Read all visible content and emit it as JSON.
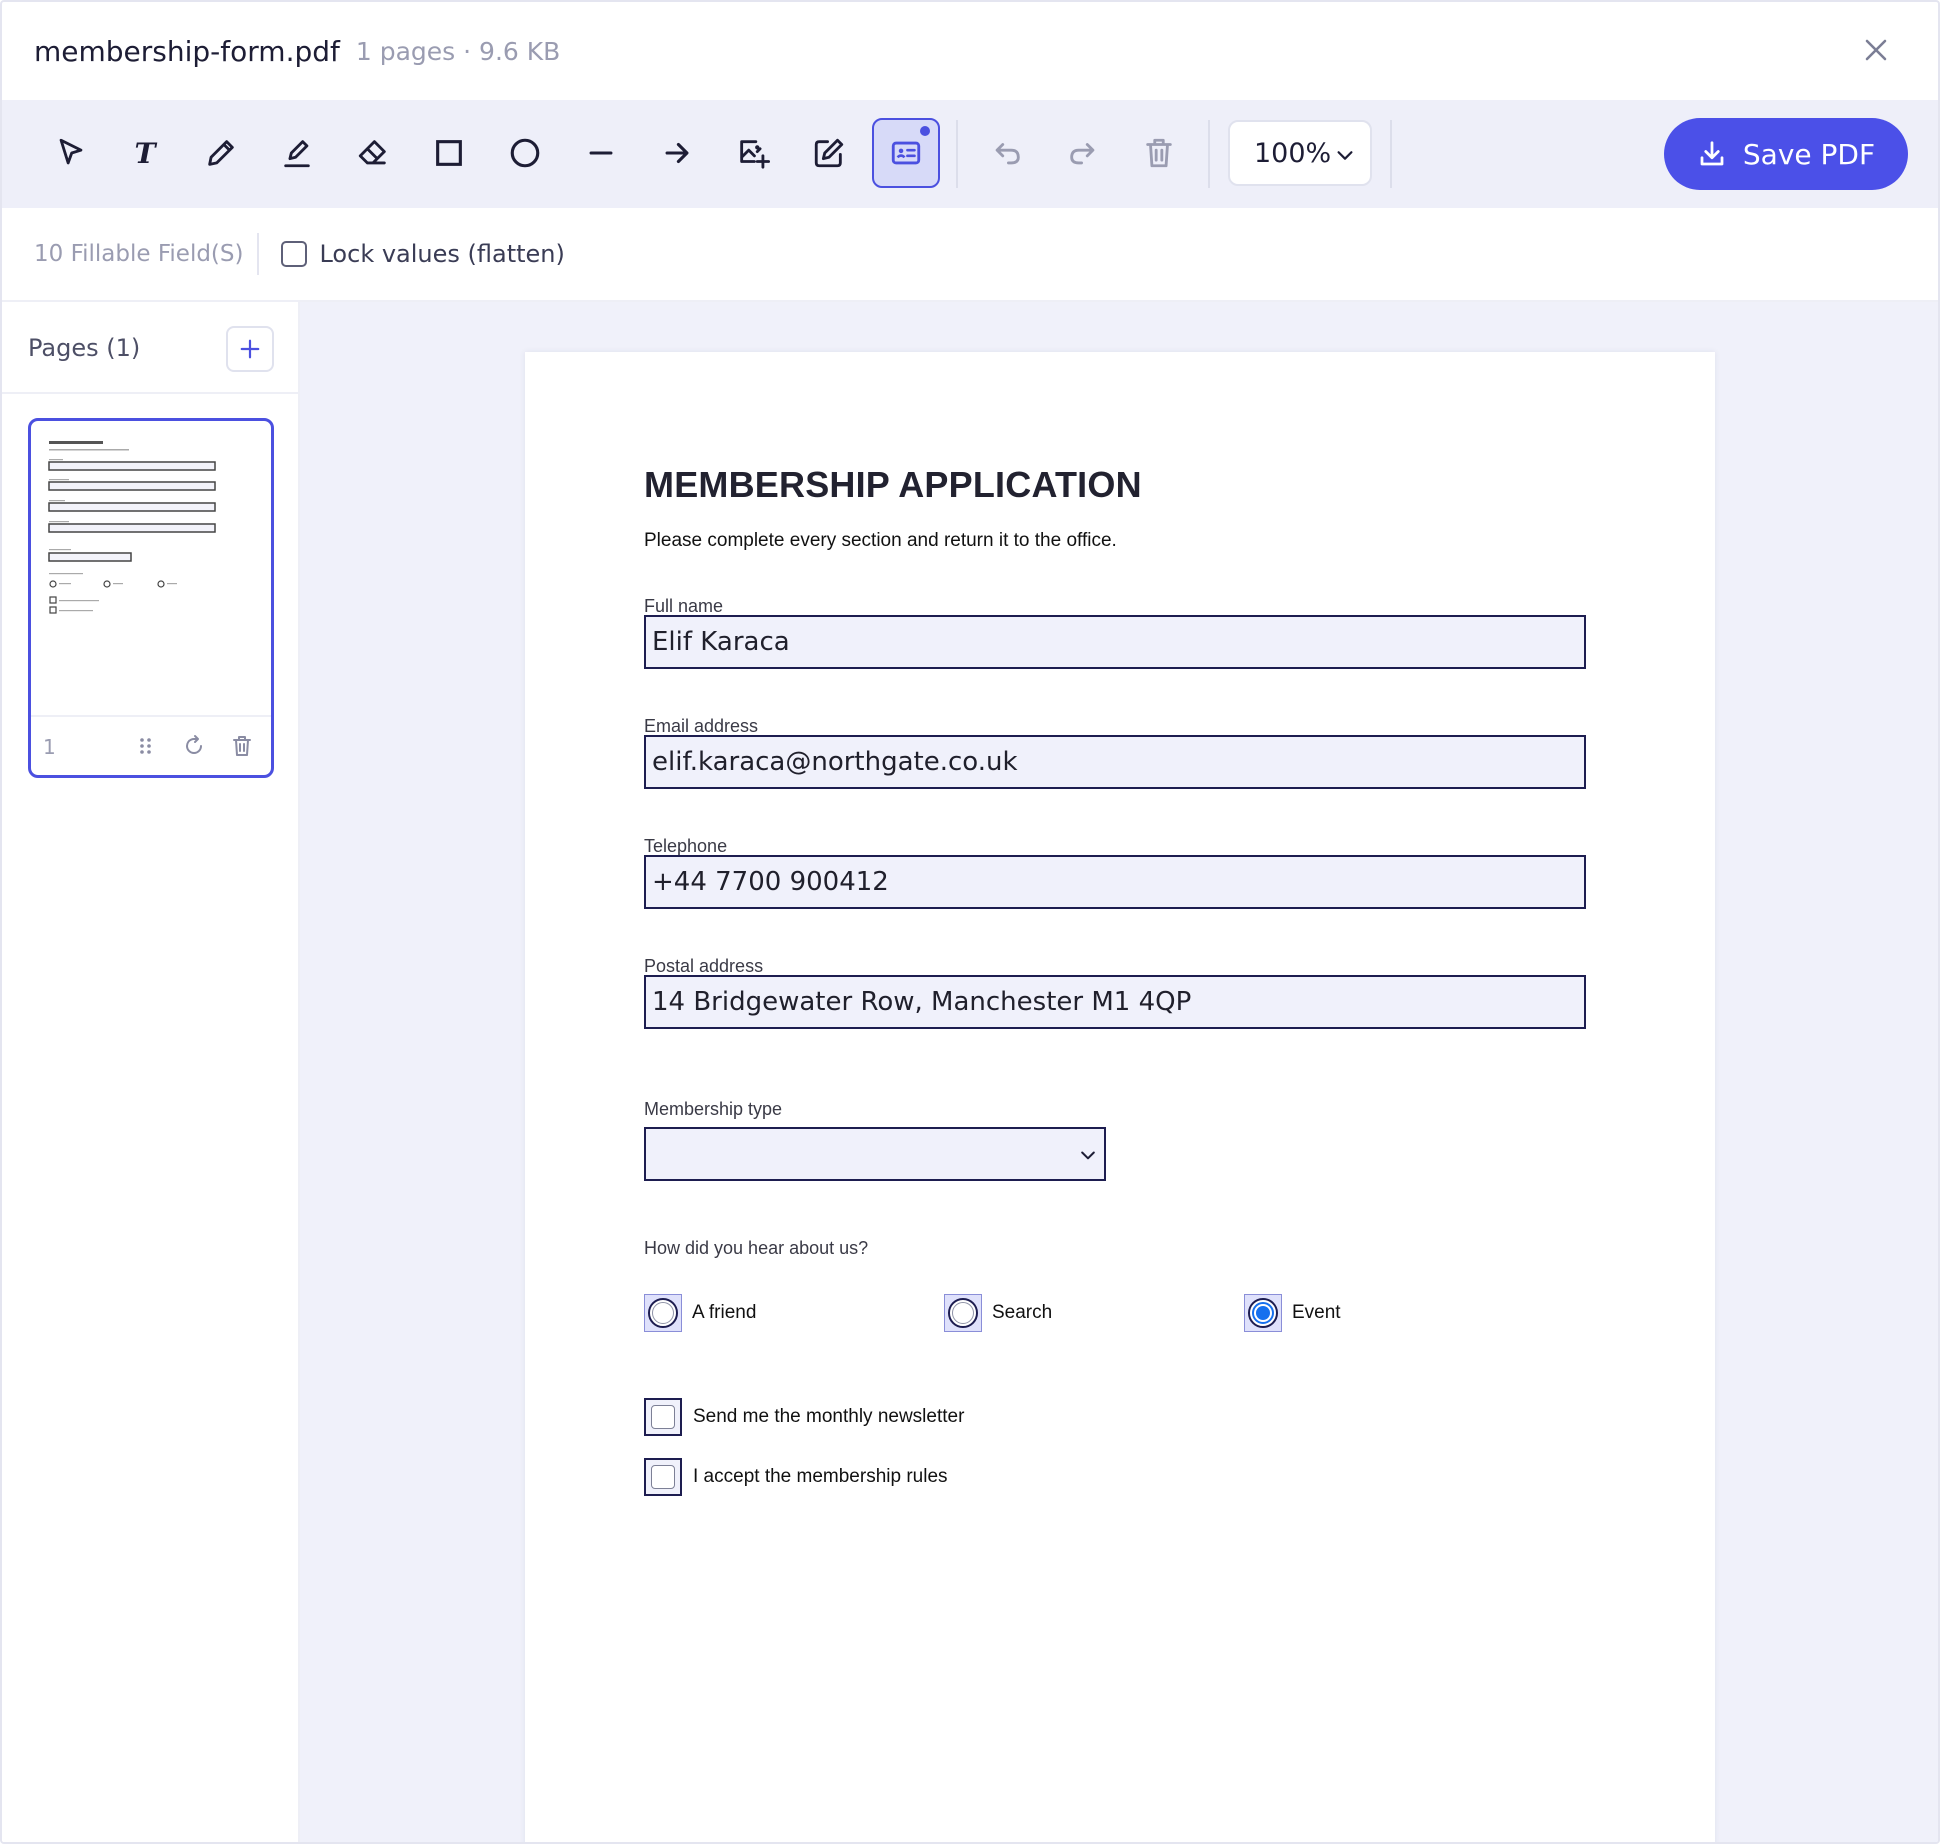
{
  "header": {
    "file_name": "membership-form.pdf",
    "file_meta": "1 pages · 9.6 KB"
  },
  "toolbar": {
    "tools": [
      "select-tool",
      "text-tool",
      "pen-tool",
      "highlighter-tool",
      "eraser-tool",
      "rectangle-tool",
      "ellipse-tool",
      "line-tool",
      "arrow-tool",
      "insert-image-tool",
      "edit-tool",
      "form-fields-tool"
    ],
    "active_tool": "form-fields-tool",
    "zoom": "100%",
    "save_label": "Save PDF",
    "accent_color": "#4b50e8"
  },
  "fields_bar": {
    "count_label": "10 Fillable Field(S)",
    "lock_label": "Lock values (flatten)",
    "lock_checked": false
  },
  "sidebar": {
    "title": "Pages (1)",
    "pages": [
      {
        "number": "1"
      }
    ]
  },
  "document": {
    "title": "MEMBERSHIP APPLICATION",
    "subtitle": "Please complete every section and return it to the office.",
    "fields": {
      "full_name": {
        "label": "Full name",
        "value": "Elif Karaca"
      },
      "email": {
        "label": "Email address",
        "value": "elif.karaca@northgate.co.uk"
      },
      "telephone": {
        "label": "Telephone",
        "value": "+44 7700 900412"
      },
      "postal": {
        "label": "Postal address",
        "value": "14 Bridgewater Row, Manchester M1 4QP"
      }
    },
    "membership_type": {
      "label": "Membership type",
      "value": ""
    },
    "hear_about": {
      "question": "How did you hear about us?",
      "options": [
        "A friend",
        "Search",
        "Event"
      ],
      "selected": "Event"
    },
    "checkboxes": {
      "newsletter": {
        "label": "Send me the monthly newsletter",
        "checked": false
      },
      "rules": {
        "label": "I accept the membership rules",
        "checked": false
      }
    }
  }
}
